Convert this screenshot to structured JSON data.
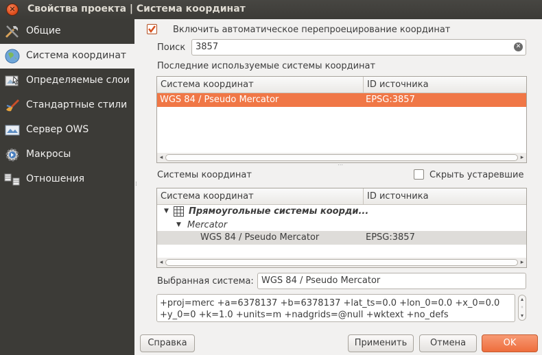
{
  "window": {
    "title": "Свойства проекта | Система координат"
  },
  "sidebar": {
    "items": [
      {
        "label": "Общие",
        "icon": "tools-icon"
      },
      {
        "label": "Система координат",
        "icon": "globe-icon"
      },
      {
        "label": "Определяемые слои",
        "icon": "layers-identify-icon"
      },
      {
        "label": "Стандартные стили",
        "icon": "brush-icon"
      },
      {
        "label": "Сервер OWS",
        "icon": "ows-server-icon"
      },
      {
        "label": "Макросы",
        "icon": "macro-gear-icon"
      },
      {
        "label": "Отношения",
        "icon": "relations-icon"
      }
    ],
    "active_index": 1
  },
  "main": {
    "otf_checkbox_label": "Включить автоматическое перепроецирование координат",
    "otf_checked": true,
    "search_label": "Поиск",
    "search_value": "3857",
    "recent_label": "Последние используемые системы координат",
    "recent_table": {
      "columns": [
        "Система координат",
        "ID источника"
      ],
      "rows": [
        {
          "name": "WGS 84 / Pseudo Mercator",
          "id": "EPSG:3857"
        }
      ]
    },
    "crs_label": "Системы координат",
    "hide_deprecated_label": "Скрыть устаревшие",
    "hide_deprecated_checked": false,
    "crs_table": {
      "columns": [
        "Система координат",
        "ID источника"
      ],
      "group": "Прямоугольные системы коорди...",
      "subgroup": "Mercator",
      "item": {
        "name": "WGS 84 / Pseudo Mercator",
        "id": "EPSG:3857"
      }
    },
    "selected_label": "Выбранная система:",
    "selected_value": "WGS 84 / Pseudo Mercator",
    "proj_line1": "+proj=merc +a=6378137 +b=6378137 +lat_ts=0.0 +lon_0=0.0 +x_0=0.0",
    "proj_line2": "+y_0=0 +k=1.0 +units=m +nadgrids=@null +wktext  +no_defs"
  },
  "buttons": {
    "help": "Справка",
    "apply": "Применить",
    "cancel": "Отмена",
    "ok": "OK"
  },
  "colors": {
    "accent": "#f07746",
    "sidebar_bg": "#3c3b37",
    "titlebar_bg": "#3c3b37"
  }
}
